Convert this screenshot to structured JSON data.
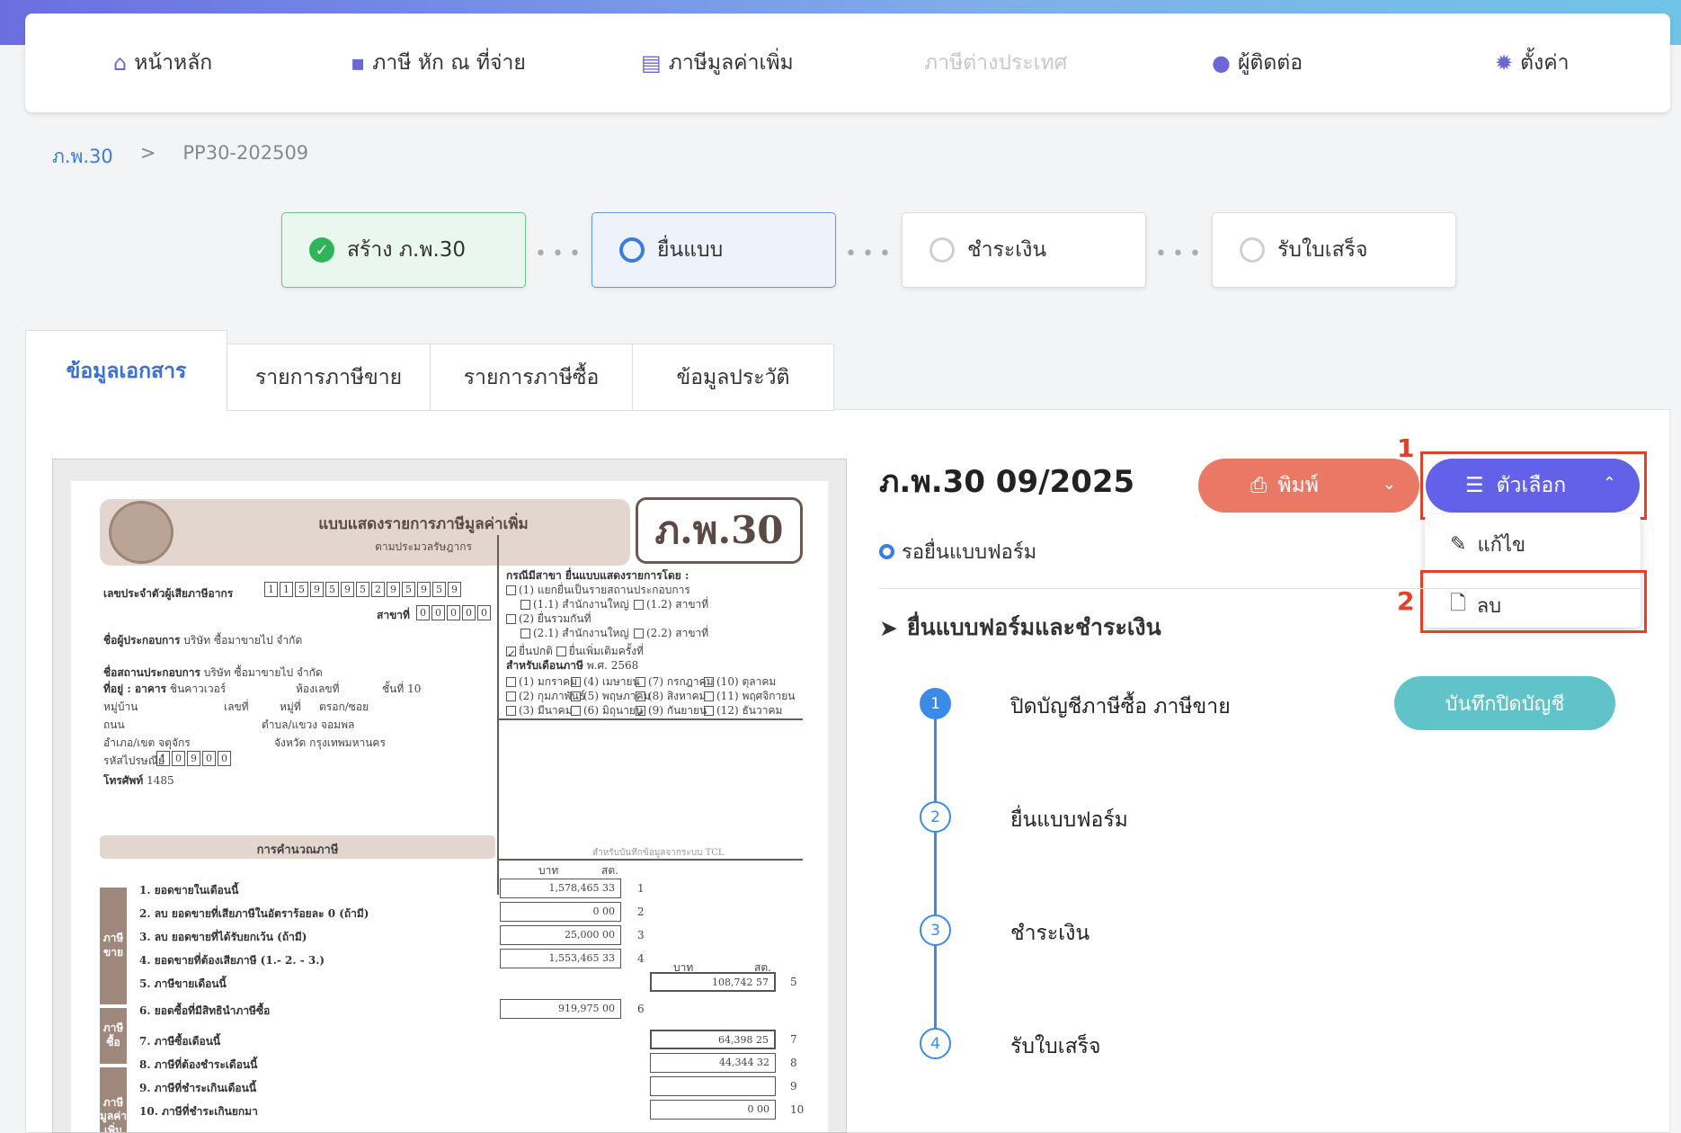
{
  "nav": {
    "home": "หน้าหลัก",
    "wht": "ภาษี หัก ณ ที่จ่าย",
    "vat": "ภาษีมูลค่าเพิ่ม",
    "foreign": "ภาษีต่างประเทศ",
    "contact": "ผู้ติดต่อ",
    "settings": "ตั้งค่า"
  },
  "breadcrumb": {
    "root": "ภ.พ.30",
    "sep": ">",
    "current": "PP30-202509"
  },
  "steps": [
    {
      "label": "สร้าง ภ.พ.30",
      "state": "done"
    },
    {
      "label": "ยื่นแบบ",
      "state": "active"
    },
    {
      "label": "ชำระเงิน",
      "state": "pending"
    },
    {
      "label": "รับใบเสร็จ",
      "state": "pending"
    }
  ],
  "tabs": [
    "ข้อมูลเอกสาร",
    "รายการภาษีขาย",
    "รายการภาษีซื้อ",
    "ข้อมูลประวัติ"
  ],
  "document": {
    "title": "ภ.พ.30 09/2025",
    "status": "รอยื่นแบบฟอร์ม",
    "print_label": "พิมพ์",
    "options_label": "ตัวเลือก",
    "menu": {
      "edit": "แก้ไข",
      "delete": "ลบ"
    },
    "annotation_1": "1",
    "annotation_2": "2"
  },
  "filing": {
    "heading": "ยื่นแบบฟอร์มและชำระเงิน",
    "steps": [
      {
        "num": "1",
        "label": "ปิดบัญชีภาษีซื้อ ภาษีขาย"
      },
      {
        "num": "2",
        "label": "ยื่นแบบฟอร์ม"
      },
      {
        "num": "3",
        "label": "ชำระเงิน"
      },
      {
        "num": "4",
        "label": "รับใบเสร็จ"
      }
    ],
    "close_button": "บันทึกปิดบัญชี"
  },
  "form": {
    "header_title": "แบบแสดงรายการภาษีมูลค่าเพิ่ม",
    "header_sub": "ตามประมวลรัษฎากร",
    "form_code": "ภ.พ.30",
    "tax_id_label": "เลขประจำตัวผู้เสียภาษีอากร",
    "tax_id": [
      "1",
      "1",
      "5",
      "9",
      "5",
      "9",
      "5",
      "2",
      "9",
      "5",
      "9",
      "5",
      "9"
    ],
    "branch_label": "สาขาที่",
    "branch": [
      "0",
      "0",
      "0",
      "0",
      "0"
    ],
    "operator_label": "ชื่อผู้ประกอบการ",
    "operator": "บริษัท ซื้อมาขายไป จำกัด",
    "place_label": "ชื่อสถานประกอบการ",
    "place": "บริษัท ซื้อมาขายไป จำกัด",
    "address_label": "ที่อยู่ : อาคาร",
    "building": "ชินคาวเวอร์",
    "room_label": "ห้องเลขที่",
    "floor_label": "ชั้นที่",
    "floor": "10",
    "village_label": "หมู่บ้าน",
    "no_label": "เลขที่",
    "moo_label": "หมู่ที่",
    "soi_label": "ตรอก/ซอย",
    "road_label": "ถนน",
    "subdistrict_label": "ตำบล/แขวง",
    "subdistrict": "จอมพล",
    "district_label": "อำเภอ/เขต",
    "district": "จตุจักร",
    "province_label": "จังหวัด",
    "province": "กรุงเทพมหานคร",
    "postcode_label": "รหัสไปรษณีย์",
    "postcode": [
      "1",
      "0",
      "9",
      "0",
      "0"
    ],
    "phone_label": "โทรศัพท์",
    "phone": "1485",
    "calc_label": "การคำนวณภาษี",
    "branch_q": "กรณีมีสาขา ยื่นแบบแสดงรายการโดย :",
    "opt1": "(1) แยกยื่นเป็นรายสถานประกอบการ",
    "opt11": "(1.1) สำนักงานใหญ่",
    "opt12": "(1.2) สาขาที่",
    "opt2": "(2) ยื่นรวมกันที่",
    "opt21": "(2.1) สำนักงานใหญ่",
    "opt22": "(2.2) สาขาที่",
    "normal": "ยื่นปกติ",
    "extra": "ยื่นเพิ่มเติมครั้งที่",
    "month_label": "สำหรับเดือนภาษี",
    "year_label": "พ.ศ.",
    "year": "2568",
    "months": [
      "(1) มกราคม",
      "(4) เมษายน",
      "(7) กรกฎาคม",
      "(10) ตุลาคม",
      "(2) กุมภาพันธ์",
      "(5) พฤษภาคม",
      "(8) สิงหาคม",
      "(11) พฤศจิกายน",
      "(3) มีนาคม",
      "(6) มิถุนายน",
      "(9) กันยายน",
      "(12) ธันวาคม"
    ],
    "tcl_note": "สำหรับบันทึกข้อมูลจากระบบ TCL",
    "baht": "บาท",
    "satang": "สต.",
    "band_sales": "ภาษีขาย",
    "band_purchase": "ภาษีซื้อ",
    "band_vat": "ภาษีมูลค่าเพิ่ม",
    "lines": [
      {
        "label": "1. ยอดขายในเดือนนี้",
        "value": "1,578,465 33",
        "no": "1"
      },
      {
        "label": "2. ลบ ยอดขายที่เสียภาษีในอัตราร้อยละ 0 (ถ้ามี)",
        "value": "0 00",
        "no": "2"
      },
      {
        "label": "3. ลบ ยอดขายที่ได้รับยกเว้น (ถ้ามี)",
        "value": "25,000 00",
        "no": "3"
      },
      {
        "label": "4. ยอดขายที่ต้องเสียภาษี (1.- 2. - 3.)",
        "value": "1,553,465 33",
        "no": "4"
      },
      {
        "label": "5. ภาษีขายเดือนนี้",
        "value": "108,742 57",
        "no": "5"
      },
      {
        "label": "6. ยอดซื้อที่มีสิทธินำภาษีซื้อ",
        "value": "919,975 00",
        "no": "6"
      },
      {
        "label": "7. ภาษีซื้อเดือนนี้",
        "value": "64,398 25",
        "no": "7"
      },
      {
        "label": "8. ภาษีที่ต้องชำระเดือนนี้",
        "value": "44,344 32",
        "no": "8"
      },
      {
        "label": "9. ภาษีที่ชำระเกินเดือนนี้",
        "value": "",
        "no": "9"
      },
      {
        "label": "10. ภาษีที่ชำระเกินยกมา",
        "value": "0 00",
        "no": "10"
      }
    ]
  }
}
